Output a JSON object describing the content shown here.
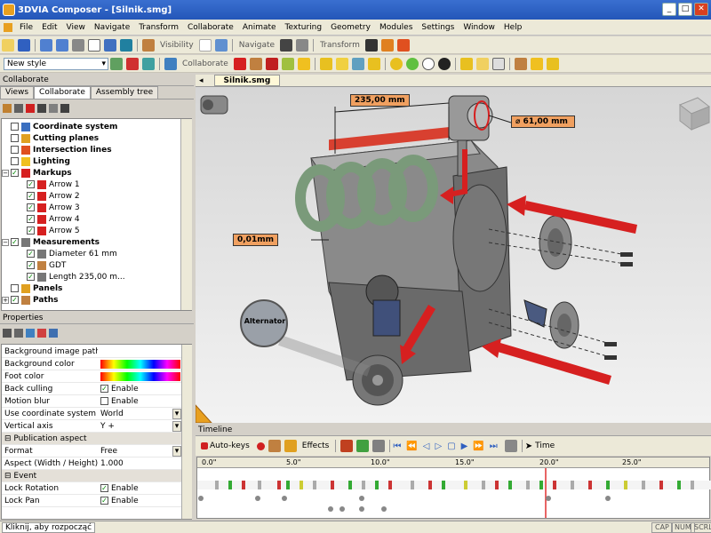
{
  "window": {
    "title": "3DVIA Composer - [Silnik.smg]"
  },
  "menu": [
    "File",
    "Edit",
    "View",
    "Navigate",
    "Transform",
    "Collaborate",
    "Animate",
    "Texturing",
    "Geometry",
    "Modules",
    "Settings",
    "Window",
    "Help"
  ],
  "toolbar": {
    "visibility_label": "Visibility",
    "navigate_label": "Navigate",
    "transform_label": "Transform",
    "collaborate_label": "Collaborate",
    "style_value": "New style"
  },
  "collaborate_panel": {
    "header": "Collaborate",
    "tabs": [
      "Views",
      "Collaborate",
      "Assembly tree"
    ],
    "tree": [
      {
        "label": "Coordinate system",
        "bold": true,
        "level": 1,
        "checked": false
      },
      {
        "label": "Cutting planes",
        "bold": true,
        "level": 1,
        "checked": false
      },
      {
        "label": "Intersection lines",
        "bold": true,
        "level": 1,
        "checked": false
      },
      {
        "label": "Lighting",
        "bold": true,
        "level": 1,
        "checked": false
      },
      {
        "label": "Markups",
        "bold": true,
        "level": 1,
        "checked": true
      },
      {
        "label": "Arrow 1",
        "bold": false,
        "level": 2,
        "checked": true
      },
      {
        "label": "Arrow 2",
        "bold": false,
        "level": 2,
        "checked": true
      },
      {
        "label": "Arrow 3",
        "bold": false,
        "level": 2,
        "checked": true
      },
      {
        "label": "Arrow 4",
        "bold": false,
        "level": 2,
        "checked": true
      },
      {
        "label": "Arrow 5",
        "bold": false,
        "level": 2,
        "checked": true
      },
      {
        "label": "Measurements",
        "bold": true,
        "level": 1,
        "checked": true
      },
      {
        "label": "Diameter 61 mm",
        "bold": false,
        "level": 2,
        "checked": true
      },
      {
        "label": "GDT",
        "bold": false,
        "level": 2,
        "checked": true
      },
      {
        "label": "Length 235,00 m...",
        "bold": false,
        "level": 2,
        "checked": true
      },
      {
        "label": "Panels",
        "bold": true,
        "level": 1,
        "checked": false
      },
      {
        "label": "Paths",
        "bold": true,
        "level": 1,
        "checked": true
      }
    ]
  },
  "properties_panel": {
    "header": "Properties",
    "rows": [
      {
        "k": "Background image path",
        "v": ""
      },
      {
        "k": "Background color",
        "v": "",
        "type": "grad"
      },
      {
        "k": "Foot color",
        "v": "",
        "type": "grad"
      },
      {
        "k": "Back culling",
        "v": "Enable",
        "type": "check",
        "checked": true
      },
      {
        "k": "Motion blur",
        "v": "Enable",
        "type": "check",
        "checked": false
      },
      {
        "k": "Use coordinate system",
        "v": "World",
        "type": "combo"
      },
      {
        "k": "Vertical axis",
        "v": "Y +",
        "type": "combo"
      },
      {
        "k": "Publication aspect",
        "v": "",
        "type": "group"
      },
      {
        "k": "Format",
        "v": "Free",
        "type": "combo"
      },
      {
        "k": "Aspect (Width / Height)",
        "v": "1.000"
      },
      {
        "k": "Event",
        "v": "",
        "type": "group"
      },
      {
        "k": "Lock Rotation",
        "v": "Enable",
        "type": "check",
        "checked": true
      },
      {
        "k": "Lock Pan",
        "v": "Enable",
        "type": "check",
        "checked": true
      }
    ]
  },
  "document": {
    "tab": "Silnik.smg"
  },
  "viewport": {
    "dim_length": "235,00 mm",
    "dim_diameter": "⌀ 61,00 mm",
    "dim_gdt": "0,01mm",
    "callout": "Alternator"
  },
  "timeline": {
    "header": "Timeline",
    "autokeys": "Auto-keys",
    "effects": "Effects",
    "time": "Time",
    "ticks": [
      "0.0\"",
      "5.0\"",
      "10.0\"",
      "15.0\"",
      "20.0\"",
      "25.0\""
    ]
  },
  "status": {
    "message": "Kliknij, aby rozpocząć",
    "cap": "CAP",
    "num": "NUM",
    "scrl": "SCRL"
  },
  "colors": {
    "accent": "#2456b8",
    "arrow": "#d62020",
    "dim_fill": "#f0a060"
  }
}
